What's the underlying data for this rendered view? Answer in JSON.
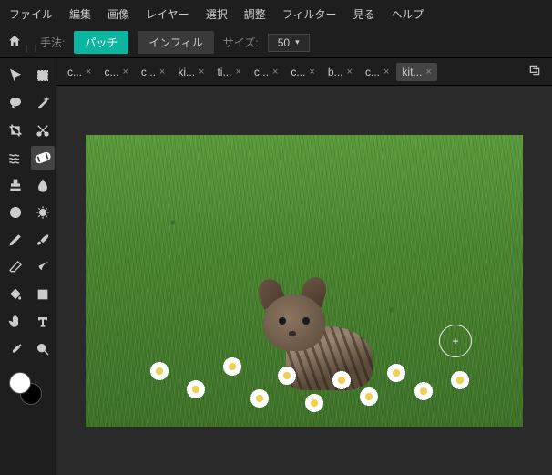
{
  "menu": [
    "ファイル",
    "編集",
    "画像",
    "レイヤー",
    "選択",
    "調整",
    "フィルター",
    "見る",
    "ヘルプ"
  ],
  "toolOptions": {
    "methodLabel": "手法:",
    "patch": "パッチ",
    "infill": "インフィル",
    "sizeLabel": "サイズ:",
    "sizeValue": "50"
  },
  "tabs": [
    {
      "label": "c...",
      "active": false
    },
    {
      "label": "c...",
      "active": false
    },
    {
      "label": "c...",
      "active": false
    },
    {
      "label": "ki...",
      "active": false
    },
    {
      "label": "ti...",
      "active": false
    },
    {
      "label": "c...",
      "active": false
    },
    {
      "label": "c...",
      "active": false
    },
    {
      "label": "b...",
      "active": false
    },
    {
      "label": "c...",
      "active": false
    },
    {
      "label": "kit...",
      "active": true
    }
  ],
  "tools": [
    "arrow",
    "marquee",
    "lasso",
    "wand",
    "crop",
    "cut",
    "liquify",
    "heal",
    "stamp",
    "blur",
    "dodge",
    "sponge",
    "pen",
    "brush",
    "eraser",
    "gradient",
    "fill",
    "shape",
    "hand",
    "type",
    "picker",
    "zoom"
  ],
  "activeTool": "heal",
  "swatch": {
    "fg": "#ffffff",
    "bg": "#000000"
  },
  "cursorGlyph": "+"
}
